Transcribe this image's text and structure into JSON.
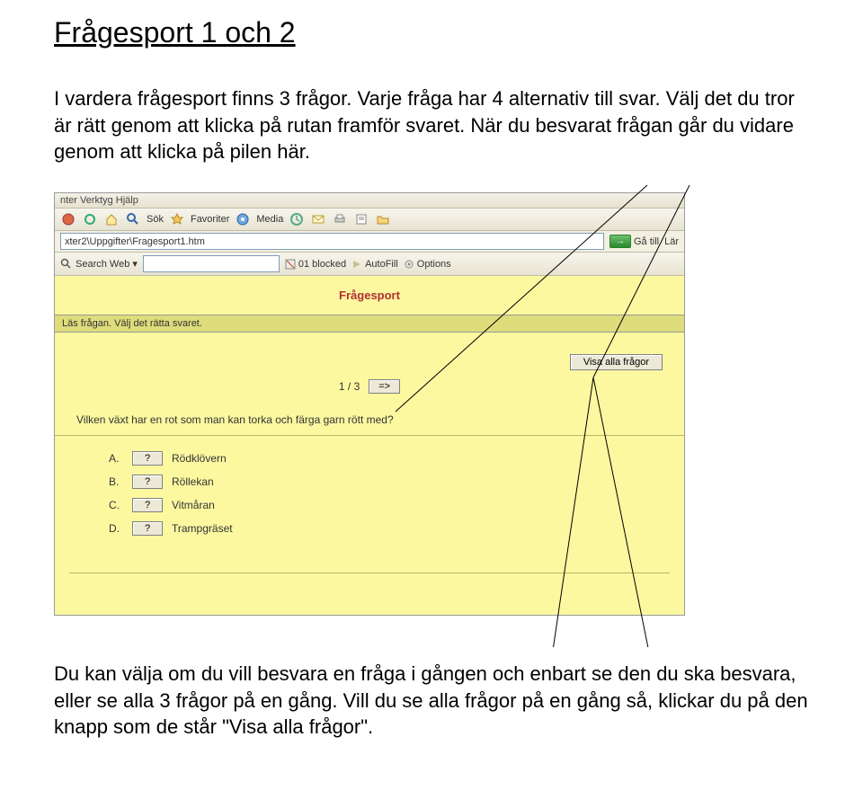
{
  "doc": {
    "title": "Frågesport 1 och 2",
    "intro": "I vardera frågesport finns 3 frågor. Varje fråga har 4 alternativ till svar. Välj det du tror är rätt genom att klicka på rutan framför svaret. När du besvarat frågan går du vidare genom att klicka på pilen här.",
    "outro": "Du kan välja om du vill besvara en fråga i gången och enbart se den du ska besvara, eller se alla 3 frågor på en gång. Vill du se alla frågor på en gång så, klickar du på den knapp som de står \"Visa alla frågor\"."
  },
  "browser": {
    "menu": "nter   Verktyg   Hjälp",
    "toolbar": {
      "sok": "Sök",
      "favoriter": "Favoriter",
      "media": "Media"
    },
    "address": "xter2\\Uppgifter\\Fragesport1.htm",
    "go": "Gå till",
    "lan": "Lär",
    "search": {
      "label": "Search Web",
      "blocked": "01 blocked",
      "autofill": "AutoFill",
      "options": "Options"
    }
  },
  "quiz": {
    "title": "Frågesport",
    "instruction": "Läs frågan. Välj det rätta svaret.",
    "show_all": "Visa alla frågor",
    "pager_count": "1 / 3",
    "next_label": "=>",
    "question": "Vilken växt har en rot som man kan torka och färga garn rött med?",
    "answer_btn": "?",
    "answers": [
      {
        "letter": "A.",
        "text": "Rödklövern"
      },
      {
        "letter": "B.",
        "text": "Röllekan"
      },
      {
        "letter": "C.",
        "text": "Vitmåran"
      },
      {
        "letter": "D.",
        "text": "Trampgräset"
      }
    ]
  }
}
